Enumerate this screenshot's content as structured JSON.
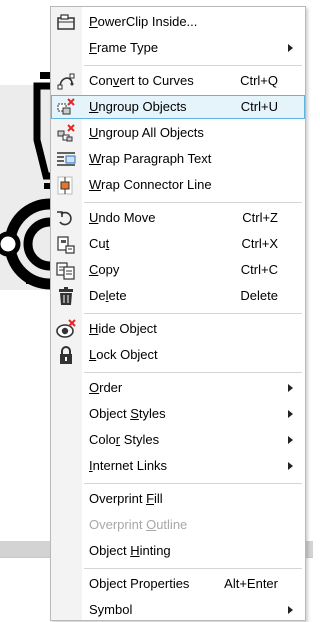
{
  "menu": {
    "groups": [
      [
        {
          "label": "PowerClip Inside...",
          "shortcut": "",
          "submenu": false,
          "icon": "powerclip-icon"
        },
        {
          "label": "Frame Type",
          "shortcut": "",
          "submenu": true,
          "icon": ""
        }
      ],
      [
        {
          "label": "Convert to Curves",
          "shortcut": "Ctrl+Q",
          "submenu": false,
          "icon": "convert-to-curves-icon"
        },
        {
          "label": "Ungroup Objects",
          "shortcut": "Ctrl+U",
          "submenu": false,
          "icon": "ungroup-icon",
          "highlighted": true
        },
        {
          "label": "Ungroup All Objects",
          "shortcut": "",
          "submenu": false,
          "icon": "ungroup-all-icon"
        },
        {
          "label": "Wrap Paragraph Text",
          "shortcut": "",
          "submenu": false,
          "icon": "wrap-text-icon"
        },
        {
          "label": "Wrap Connector Line",
          "shortcut": "",
          "submenu": false,
          "icon": "wrap-connector-icon"
        }
      ],
      [
        {
          "label": "Undo Move",
          "shortcut": "Ctrl+Z",
          "submenu": false,
          "icon": "undo-icon"
        },
        {
          "label": "Cut",
          "shortcut": "Ctrl+X",
          "submenu": false,
          "icon": "cut-icon"
        },
        {
          "label": "Copy",
          "shortcut": "Ctrl+C",
          "submenu": false,
          "icon": "copy-icon"
        },
        {
          "label": "Delete",
          "shortcut": "Delete",
          "submenu": false,
          "icon": "trash-icon"
        }
      ],
      [
        {
          "label": "Hide Object",
          "shortcut": "",
          "submenu": false,
          "icon": "hide-object-icon"
        },
        {
          "label": "Lock Object",
          "shortcut": "",
          "submenu": false,
          "icon": "lock-icon"
        }
      ],
      [
        {
          "label": "Order",
          "shortcut": "",
          "submenu": true,
          "icon": ""
        },
        {
          "label": "Object Styles",
          "shortcut": "",
          "submenu": true,
          "icon": ""
        },
        {
          "label": "Color Styles",
          "shortcut": "",
          "submenu": true,
          "icon": ""
        },
        {
          "label": "Internet Links",
          "shortcut": "",
          "submenu": true,
          "icon": ""
        }
      ],
      [
        {
          "label": "Overprint Fill",
          "shortcut": "",
          "submenu": false,
          "icon": ""
        },
        {
          "label": "Overprint Outline",
          "shortcut": "",
          "submenu": false,
          "icon": "",
          "disabled": true
        },
        {
          "label": "Object Hinting",
          "shortcut": "",
          "submenu": false,
          "icon": ""
        }
      ],
      [
        {
          "label": "Object Properties",
          "shortcut": "Alt+Enter",
          "submenu": false,
          "icon": ""
        },
        {
          "label": "Symbol",
          "shortcut": "",
          "submenu": true,
          "icon": ""
        }
      ]
    ],
    "mnemonics": {
      "PowerClip Inside...": 0,
      "Frame Type": 0,
      "Convert to Curves": 3,
      "Ungroup Objects": 0,
      "Ungroup All Objects": 0,
      "Wrap Paragraph Text": 0,
      "Wrap Connector Line": 0,
      "Undo Move": 0,
      "Cut": 2,
      "Copy": 0,
      "Delete": 2,
      "Hide Object": 0,
      "Lock Object": 0,
      "Order": 0,
      "Object Styles": 7,
      "Color Styles": 4,
      "Internet Links": 0,
      "Overprint Fill": 10,
      "Overprint Outline": 10,
      "Object Hinting": 7
    }
  },
  "colors": {
    "highlight_bg": "#e5f3fb",
    "highlight_border": "#5fb5e2",
    "disabled_text": "#a8a8a8",
    "accent_red": "#e32626",
    "accent_orange": "#e5762b",
    "accent_blue": "#2b6cc4"
  }
}
